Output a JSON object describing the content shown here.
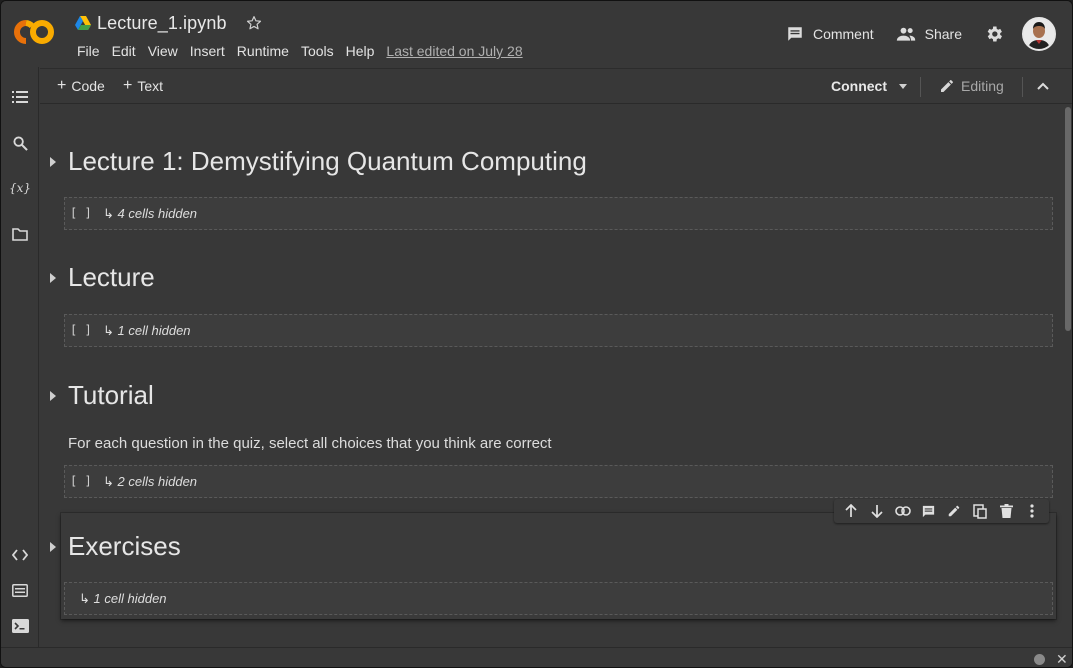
{
  "header": {
    "notebook_title": "Lecture_1.ipynb",
    "menu": [
      "File",
      "Edit",
      "View",
      "Insert",
      "Runtime",
      "Tools",
      "Help"
    ],
    "last_edited": "Last edited on July 28",
    "comment_label": "Comment",
    "share_label": "Share"
  },
  "toolbar": {
    "code_label": "Code",
    "text_label": "Text",
    "connect_label": "Connect",
    "editing_label": "Editing"
  },
  "sections": [
    {
      "title": "Lecture 1: Demystifying Quantum Computing",
      "hidden": "4 cells hidden",
      "bracket": "[ ]"
    },
    {
      "title": "Lecture",
      "hidden": "1 cell hidden",
      "bracket": "[ ]"
    },
    {
      "title": "Tutorial",
      "hidden": "2 cells hidden",
      "bracket": "[ ]",
      "description": "For each question in the quiz, select all choices that you think are correct"
    },
    {
      "title": "Exercises",
      "hidden": "1 cell hidden",
      "bracket": ""
    }
  ],
  "hidden_arrow": "↳",
  "rail_icons": [
    "table-of-contents-icon",
    "search-icon",
    "variables-icon",
    "files-icon",
    "code-snippets-icon",
    "command-palette-icon",
    "terminal-icon"
  ],
  "cell_toolbar_icons": [
    "move-up-icon",
    "move-down-icon",
    "link-icon",
    "comment-icon",
    "edit-icon",
    "mirror-cell-icon",
    "delete-icon",
    "more-vert-icon"
  ],
  "colors": {
    "background": "#383838",
    "logo_orange": "#F9AB00",
    "logo_dark_orange": "#E8710A"
  }
}
